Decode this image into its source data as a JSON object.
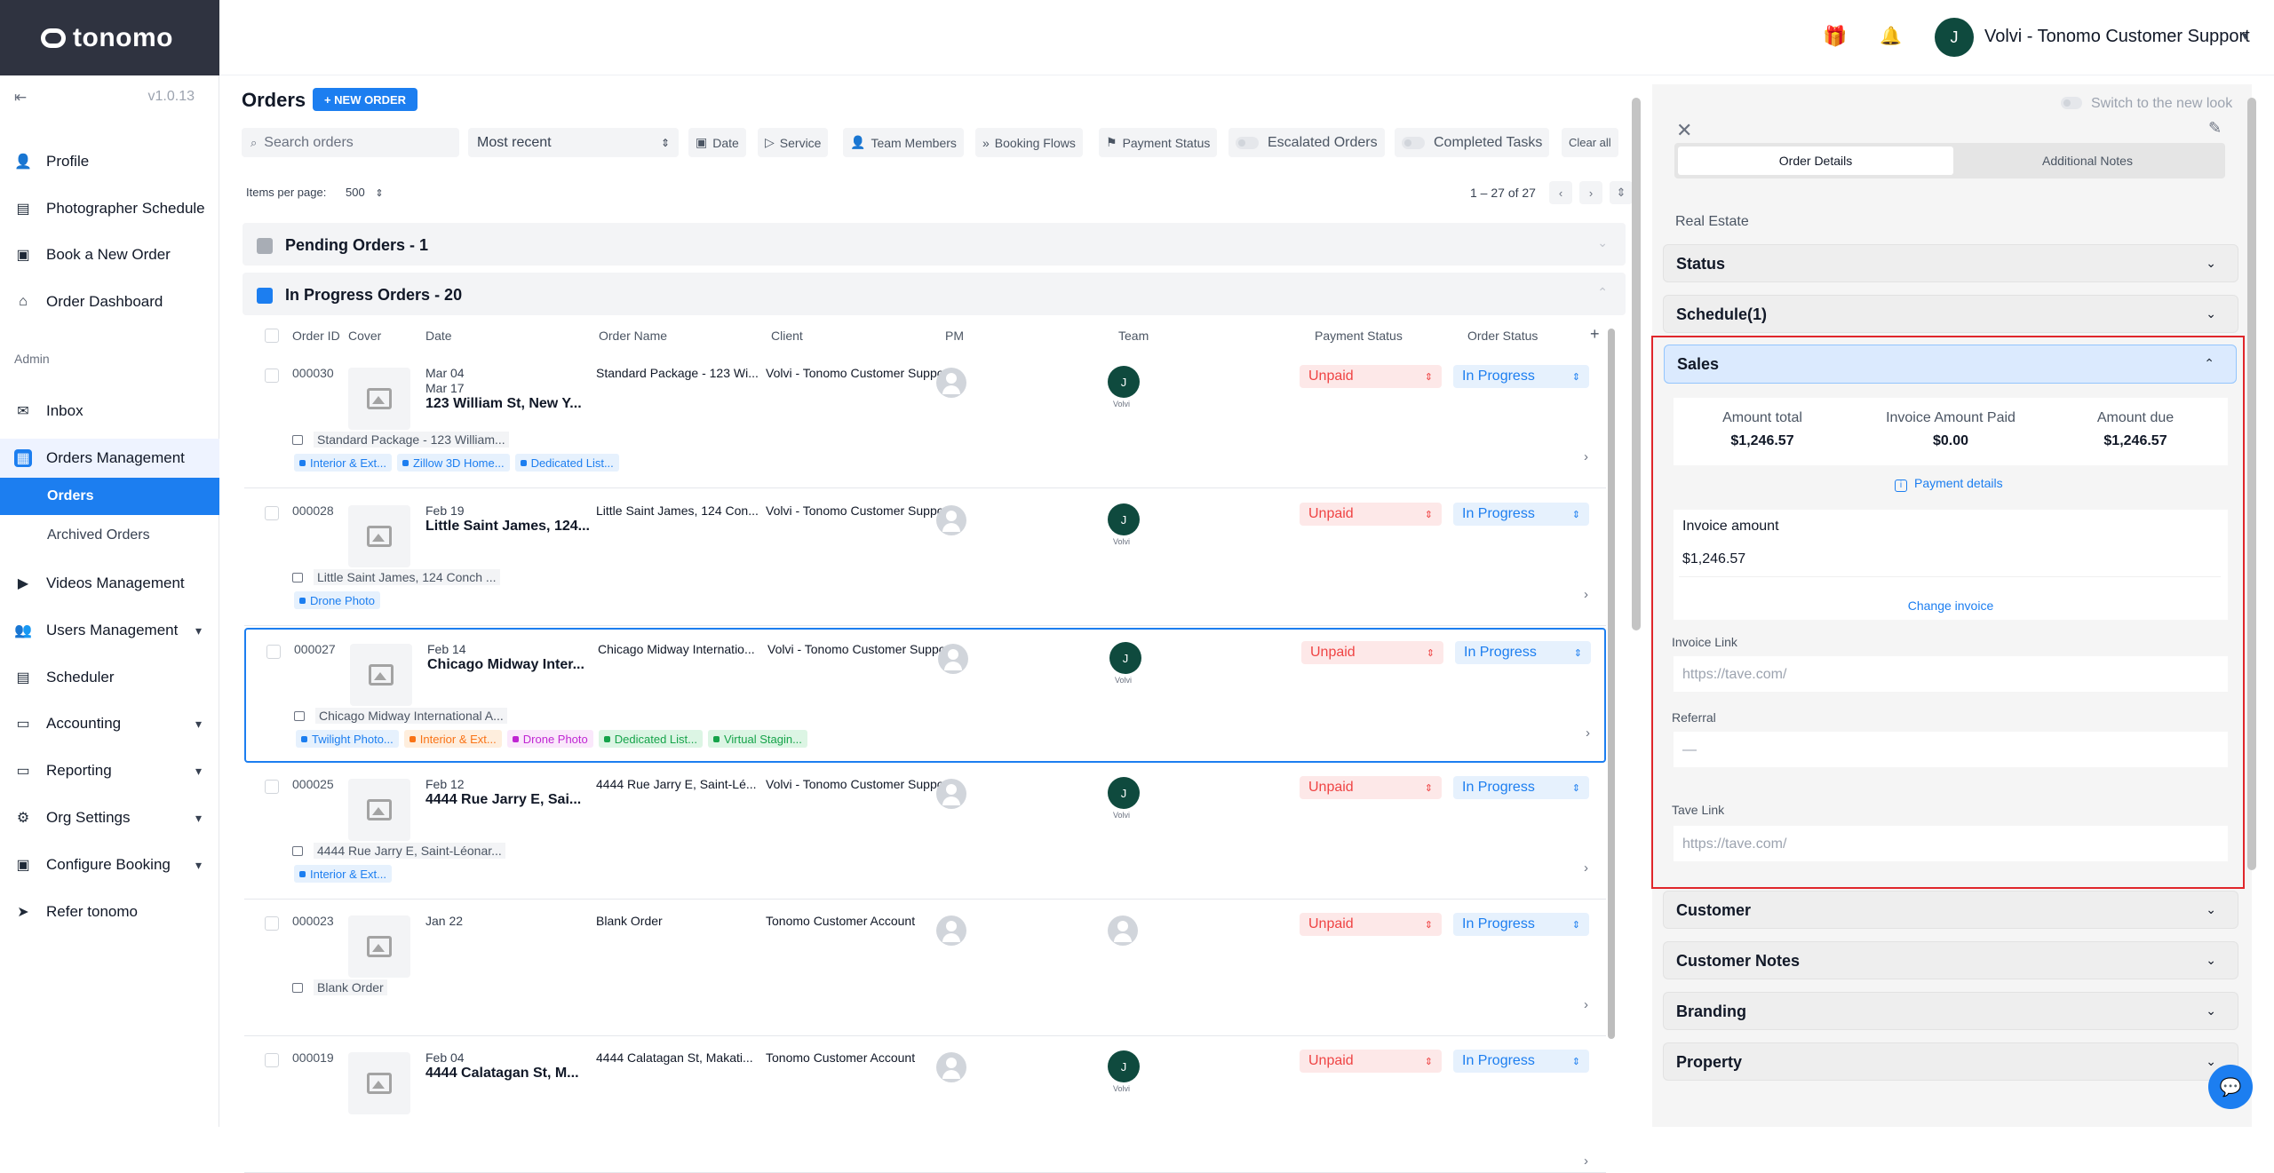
{
  "app": {
    "logo": "tonomo",
    "version": "v1.0.13",
    "collapse_icon": "⇤"
  },
  "sidebar": {
    "items": [
      {
        "label": "Profile",
        "icon": "user-icon"
      },
      {
        "label": "Photographer Schedule",
        "icon": "calendar-icon"
      },
      {
        "label": "Book a New Order",
        "icon": "book-icon"
      },
      {
        "label": "Order Dashboard",
        "icon": "home-icon"
      }
    ],
    "admin_label": "Admin",
    "admin_items": [
      {
        "label": "Inbox",
        "icon": "mail-icon"
      },
      {
        "label": "Orders Management",
        "icon": "orders-icon"
      },
      {
        "label": "Videos Management",
        "icon": "video-icon"
      },
      {
        "label": "Users Management",
        "icon": "users-icon"
      },
      {
        "label": "Scheduler",
        "icon": "scheduler-icon"
      },
      {
        "label": "Accounting",
        "icon": "accounting-icon"
      },
      {
        "label": "Reporting",
        "icon": "reporting-icon"
      },
      {
        "label": "Org Settings",
        "icon": "gear-icon"
      },
      {
        "label": "Configure Booking",
        "icon": "configure-icon"
      },
      {
        "label": "Refer tonomo",
        "icon": "send-icon"
      }
    ],
    "sub_items": [
      {
        "label": "Orders"
      },
      {
        "label": "Archived Orders"
      }
    ]
  },
  "header": {
    "user_initial": "J",
    "user_name": "Volvi - Tonomo Customer Support"
  },
  "orders": {
    "title": "Orders",
    "new_order": "+ NEW ORDER",
    "search_placeholder": "Search orders",
    "sort": "Most recent",
    "filters": [
      "Date",
      "Service",
      "Team Members",
      "Booking Flows",
      "Payment Status"
    ],
    "toggles": [
      "Escalated Orders",
      "Completed Tasks"
    ],
    "clear_all": "Clear all",
    "items_per_page_label": "Items per page:",
    "items_per_page": "500",
    "range": "1 – 27 of 27",
    "groups": [
      {
        "label": "Pending Orders - 1",
        "color": "#a8adb5"
      },
      {
        "label": "In Progress Orders - 20",
        "color": "#1c7ef0"
      }
    ],
    "columns": [
      "Order ID",
      "Cover",
      "Date",
      "Order Name",
      "Client",
      "PM",
      "Team",
      "Payment Status",
      "Order Status"
    ],
    "rows": [
      {
        "id": "000030",
        "date1": "Mar 04",
        "date2": "Mar 17",
        "title": "123 William St, New Y...",
        "name": "Standard Package - 123 Wi...",
        "client": "Volvi - Tonomo Customer Support",
        "team": "J",
        "team_label": "Volvi",
        "payment": "Unpaid",
        "status": "In Progress",
        "addr": "Standard Package - 123 William...",
        "tags": [
          {
            "t": "Interior & Ext...",
            "c": "#1c7ef0",
            "bg": "#e6f1fd"
          },
          {
            "t": "Zillow 3D Home...",
            "c": "#1c7ef0",
            "bg": "#e6f1fd"
          },
          {
            "t": "Dedicated List...",
            "c": "#1c7ef0",
            "bg": "#e6f1fd"
          }
        ]
      },
      {
        "id": "000028",
        "date1": "Feb 19",
        "date2": "",
        "title": "Little Saint James, 124...",
        "name": "Little Saint James, 124 Con...",
        "client": "Volvi - Tonomo Customer Support",
        "team": "J",
        "team_label": "Volvi",
        "payment": "Unpaid",
        "status": "In Progress",
        "addr": "Little Saint James, 124 Conch ...",
        "tags": [
          {
            "t": "Drone Photo",
            "c": "#1c7ef0",
            "bg": "#e6f1fd"
          }
        ]
      },
      {
        "id": "000027",
        "date1": "Feb 14",
        "date2": "",
        "title": "Chicago Midway Inter...",
        "name": "Chicago Midway Internatio...",
        "client": "Volvi - Tonomo Customer Support",
        "team": "J",
        "team_label": "Volvi",
        "payment": "Unpaid",
        "status": "In Progress",
        "addr": "Chicago Midway International A...",
        "tags": [
          {
            "t": "Twilight Photo...",
            "c": "#1c7ef0",
            "bg": "#e6f1fd"
          },
          {
            "t": "Interior & Ext...",
            "c": "#f97316",
            "bg": "#feeedd"
          },
          {
            "t": "Drone Photo",
            "c": "#c026d3",
            "bg": "#fae8fb"
          },
          {
            "t": "Dedicated List...",
            "c": "#16a34a",
            "bg": "#dcf5e4"
          },
          {
            "t": "Virtual Stagin...",
            "c": "#16a34a",
            "bg": "#dcf5e4"
          }
        ]
      },
      {
        "id": "000025",
        "date1": "Feb 12",
        "date2": "",
        "title": "4444 Rue Jarry E, Sai...",
        "name": "4444 Rue Jarry E, Saint-Lé...",
        "client": "Volvi - Tonomo Customer Support",
        "team": "J",
        "team_label": "Volvi",
        "payment": "Unpaid",
        "status": "In Progress",
        "addr": "4444 Rue Jarry E, Saint-Léonar...",
        "tags": [
          {
            "t": "Interior & Ext...",
            "c": "#1c7ef0",
            "bg": "#e6f1fd"
          }
        ]
      },
      {
        "id": "000023",
        "date1": "Jan 22",
        "date2": "",
        "title": "",
        "name": "Blank Order",
        "client": "Tonomo Customer Account",
        "team": "",
        "team_label": "",
        "payment": "Unpaid",
        "status": "In Progress",
        "addr": "Blank Order",
        "tags": []
      },
      {
        "id": "000019",
        "date1": "Feb 04",
        "date2": "",
        "title": "4444 Calatagan St, M...",
        "name": "4444 Calatagan St, Makati...",
        "client": "Tonomo Customer Account",
        "team": "J",
        "team_label": "Volvi",
        "payment": "Unpaid",
        "status": "In Progress",
        "addr": "",
        "tags": []
      }
    ]
  },
  "panel": {
    "switch_look": "Switch to the new look",
    "tabs": [
      "Order Details",
      "Additional Notes"
    ],
    "category": "Real Estate",
    "sections_top": [
      "Status",
      "Schedule(1)"
    ],
    "sales_title": "Sales",
    "amounts": [
      {
        "label": "Amount total",
        "value": "$1,246.57"
      },
      {
        "label": "Invoice Amount Paid",
        "value": "$0.00"
      },
      {
        "label": "Amount due",
        "value": "$1,246.57"
      }
    ],
    "payment_details": "Payment details",
    "invoice_amount_label": "Invoice amount",
    "invoice_amount": "$1,246.57",
    "change_invoice": "Change invoice",
    "invoice_link_label": "Invoice Link",
    "invoice_link_placeholder": "https://tave.com/",
    "referral_label": "Referral",
    "referral_value": "—",
    "tave_link_label": "Tave Link",
    "tave_link_placeholder": "https://tave.com/",
    "sections_bottom": [
      "Customer",
      "Customer Notes",
      "Branding",
      "Property"
    ]
  }
}
